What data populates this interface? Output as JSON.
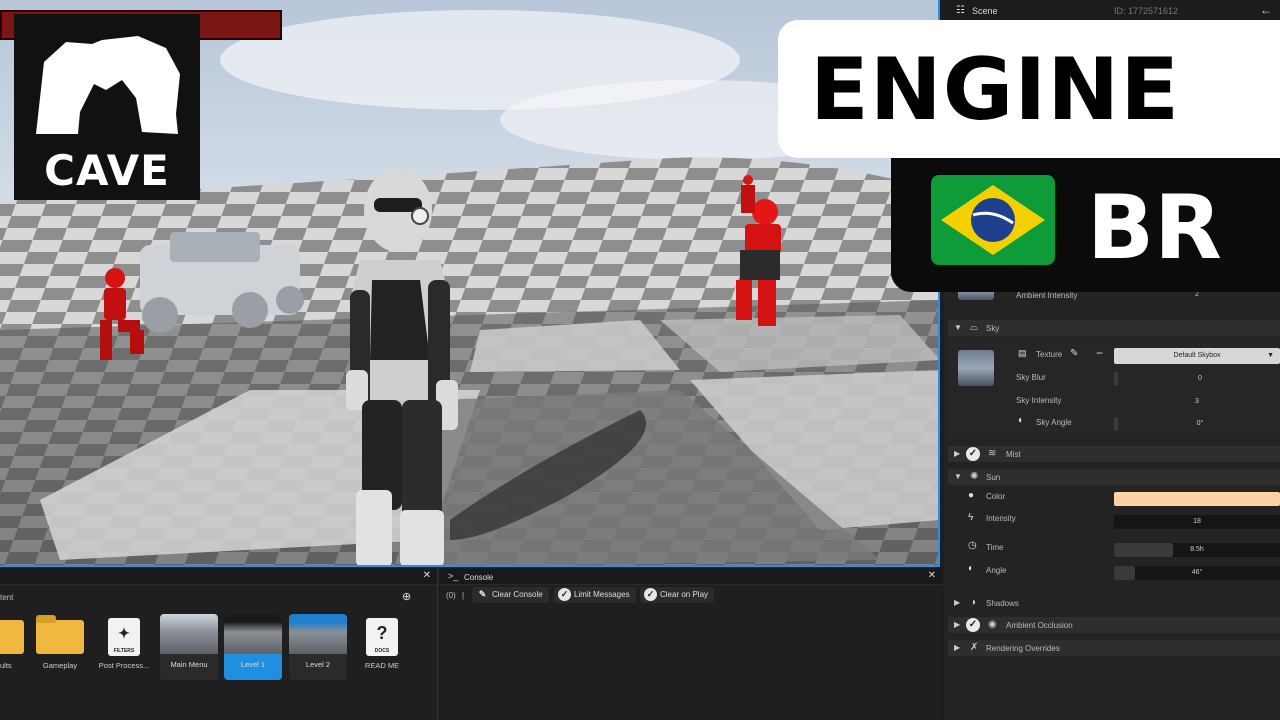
{
  "logo": {
    "text": "CAVE"
  },
  "banner": {
    "line1": "ENGINE",
    "line2": "BR"
  },
  "inspector": {
    "tab": "Scene",
    "id": "ID: 1772571612",
    "ambient": {
      "label": "Ambient Intensity",
      "value": "2"
    },
    "sky": {
      "title": "Sky",
      "texture_label": "Texture",
      "texture_value": "Default Skybox",
      "blur_label": "Sky Blur",
      "blur_value": "0",
      "intensity_label": "Sky Intensity",
      "intensity_value": "3",
      "angle_label": "Sky Angle",
      "angle_value": "0°"
    },
    "mist": {
      "title": "Mist"
    },
    "sun": {
      "title": "Sun",
      "color_label": "Color",
      "color_value": "#ffd3a4",
      "intensity_label": "Intensity",
      "intensity_value": "18",
      "time_label": "Time",
      "time_value": "8.5h",
      "time_fraction": 0.354,
      "angle_label": "Angle",
      "angle_value": "46°",
      "angle_fraction": 0.128
    },
    "shadows": {
      "title": "Shadows"
    },
    "ao": {
      "title": "Ambient Occlusion"
    },
    "overrides": {
      "title": "Rendering Overrides"
    }
  },
  "content": {
    "title": "tent",
    "items": [
      {
        "label": "ults"
      },
      {
        "label": "Gameplay"
      },
      {
        "label": "Post Process...",
        "icon_tag": "FILTERS"
      },
      {
        "label": "Main Menu"
      },
      {
        "label": "Level 1"
      },
      {
        "label": "Level 2"
      },
      {
        "label": "READ ME",
        "icon_tag": "DOCS"
      }
    ]
  },
  "console": {
    "tab": "Console",
    "count": "(0)",
    "separator": "|",
    "clear_label": "Clear Console",
    "limit_label": "Limit Messages",
    "clear_play_label": "Clear on Play"
  }
}
